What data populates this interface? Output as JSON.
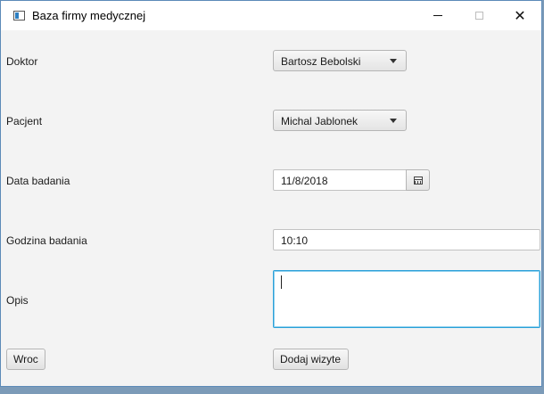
{
  "window": {
    "title": "Baza firmy medycznej",
    "icons": {
      "app": "app-window-icon",
      "minimize": "minimize-icon",
      "maximize": "maximize-icon",
      "close": "close-icon"
    },
    "close_glyph": "✕"
  },
  "form": {
    "doctor": {
      "label": "Doktor",
      "value": "Bartosz Bebolski"
    },
    "patient": {
      "label": "Pacjent",
      "value": "Michal Jablonek"
    },
    "date": {
      "label": "Data badania",
      "value": "11/8/2018",
      "icon": "calendar-icon"
    },
    "time": {
      "label": "Godzina badania",
      "value": "10:10"
    },
    "description": {
      "label": "Opis",
      "value": ""
    }
  },
  "buttons": {
    "back": "Wroc",
    "add_visit": "Dodaj wizyte"
  },
  "colors": {
    "focus_border": "#2aa0d8",
    "window_bg": "#f3f3f3",
    "titlebar_bg": "#ffffff"
  }
}
